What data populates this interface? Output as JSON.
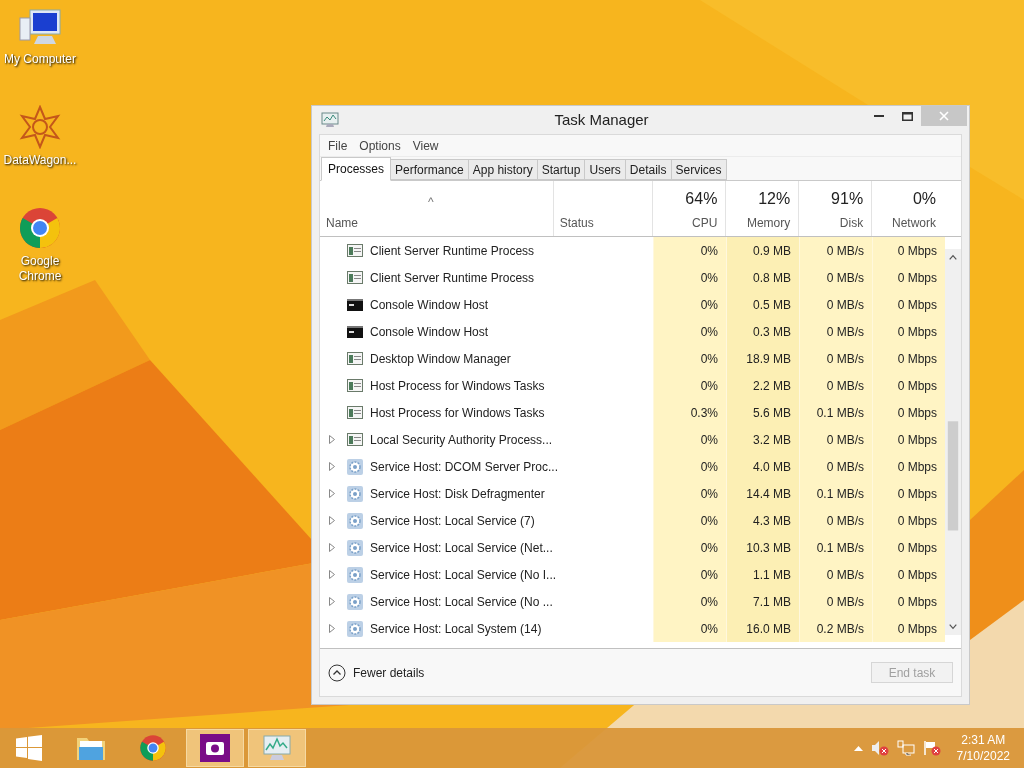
{
  "desktop_icons": [
    {
      "label": "My Computer",
      "kind": "computer"
    },
    {
      "label": "DataWagon...",
      "kind": "star"
    },
    {
      "label": "Google Chrome",
      "kind": "chrome"
    }
  ],
  "window": {
    "title": "Task Manager"
  },
  "menu": [
    "File",
    "Options",
    "View"
  ],
  "tabs": [
    {
      "label": "Processes",
      "selected": true
    },
    {
      "label": "Performance",
      "selected": false
    },
    {
      "label": "App history",
      "selected": false
    },
    {
      "label": "Startup",
      "selected": false
    },
    {
      "label": "Users",
      "selected": false
    },
    {
      "label": "Details",
      "selected": false
    },
    {
      "label": "Services",
      "selected": false
    }
  ],
  "table": {
    "sort_arrow": "^",
    "columns": [
      {
        "label": "Name"
      },
      {
        "label": "Status"
      },
      {
        "label": "CPU",
        "usage": "64%"
      },
      {
        "label": "Memory",
        "usage": "12%"
      },
      {
        "label": "Disk",
        "usage": "91%"
      },
      {
        "label": "Network",
        "usage": "0%"
      }
    ],
    "rows": [
      {
        "name": "Client Server Runtime Process",
        "kind": "window",
        "expandable": false,
        "cpu": "0%",
        "memory": "0.9 MB",
        "disk": "0 MB/s",
        "network": "0 Mbps"
      },
      {
        "name": "Client Server Runtime Process",
        "kind": "window",
        "expandable": false,
        "cpu": "0%",
        "memory": "0.8 MB",
        "disk": "0 MB/s",
        "network": "0 Mbps"
      },
      {
        "name": "Console Window Host",
        "kind": "console",
        "expandable": false,
        "cpu": "0%",
        "memory": "0.5 MB",
        "disk": "0 MB/s",
        "network": "0 Mbps"
      },
      {
        "name": "Console Window Host",
        "kind": "console",
        "expandable": false,
        "cpu": "0%",
        "memory": "0.3 MB",
        "disk": "0 MB/s",
        "network": "0 Mbps"
      },
      {
        "name": "Desktop Window Manager",
        "kind": "window",
        "expandable": false,
        "cpu": "0%",
        "memory": "18.9 MB",
        "disk": "0 MB/s",
        "network": "0 Mbps"
      },
      {
        "name": "Host Process for Windows Tasks",
        "kind": "window",
        "expandable": false,
        "cpu": "0%",
        "memory": "2.2 MB",
        "disk": "0 MB/s",
        "network": "0 Mbps"
      },
      {
        "name": "Host Process for Windows Tasks",
        "kind": "window",
        "expandable": false,
        "cpu": "0.3%",
        "memory": "5.6 MB",
        "disk": "0.1 MB/s",
        "network": "0 Mbps"
      },
      {
        "name": "Local Security Authority Process...",
        "kind": "window",
        "expandable": true,
        "cpu": "0%",
        "memory": "3.2 MB",
        "disk": "0 MB/s",
        "network": "0 Mbps"
      },
      {
        "name": "Service Host: DCOM Server Proc...",
        "kind": "gear",
        "expandable": true,
        "cpu": "0%",
        "memory": "4.0 MB",
        "disk": "0 MB/s",
        "network": "0 Mbps"
      },
      {
        "name": "Service Host: Disk Defragmenter",
        "kind": "gear",
        "expandable": true,
        "cpu": "0%",
        "memory": "14.4 MB",
        "disk": "0.1 MB/s",
        "network": "0 Mbps"
      },
      {
        "name": "Service Host: Local Service (7)",
        "kind": "gear",
        "expandable": true,
        "cpu": "0%",
        "memory": "4.3 MB",
        "disk": "0 MB/s",
        "network": "0 Mbps"
      },
      {
        "name": "Service Host: Local Service (Net...",
        "kind": "gear",
        "expandable": true,
        "cpu": "0%",
        "memory": "10.3 MB",
        "disk": "0.1 MB/s",
        "network": "0 Mbps"
      },
      {
        "name": "Service Host: Local Service (No I...",
        "kind": "gear",
        "expandable": true,
        "cpu": "0%",
        "memory": "1.1 MB",
        "disk": "0 MB/s",
        "network": "0 Mbps"
      },
      {
        "name": "Service Host: Local Service (No ...",
        "kind": "gear",
        "expandable": true,
        "cpu": "0%",
        "memory": "7.1 MB",
        "disk": "0 MB/s",
        "network": "0 Mbps"
      },
      {
        "name": "Service Host: Local System (14)",
        "kind": "gear",
        "expandable": true,
        "cpu": "0%",
        "memory": "16.0 MB",
        "disk": "0.2 MB/s",
        "network": "0 Mbps"
      }
    ]
  },
  "footer": {
    "fewer_details": "Fewer details",
    "end_task": {
      "label": "End task",
      "disabled": true
    }
  },
  "taskbar": {
    "apps": [
      {
        "kind": "start",
        "running": false
      },
      {
        "kind": "folder",
        "running": false
      },
      {
        "kind": "chrome",
        "running": false
      },
      {
        "kind": "camera",
        "running": true
      },
      {
        "kind": "monitor",
        "running": true
      }
    ],
    "clock": {
      "time": "2:31 AM",
      "date": "7/10/2022"
    }
  }
}
